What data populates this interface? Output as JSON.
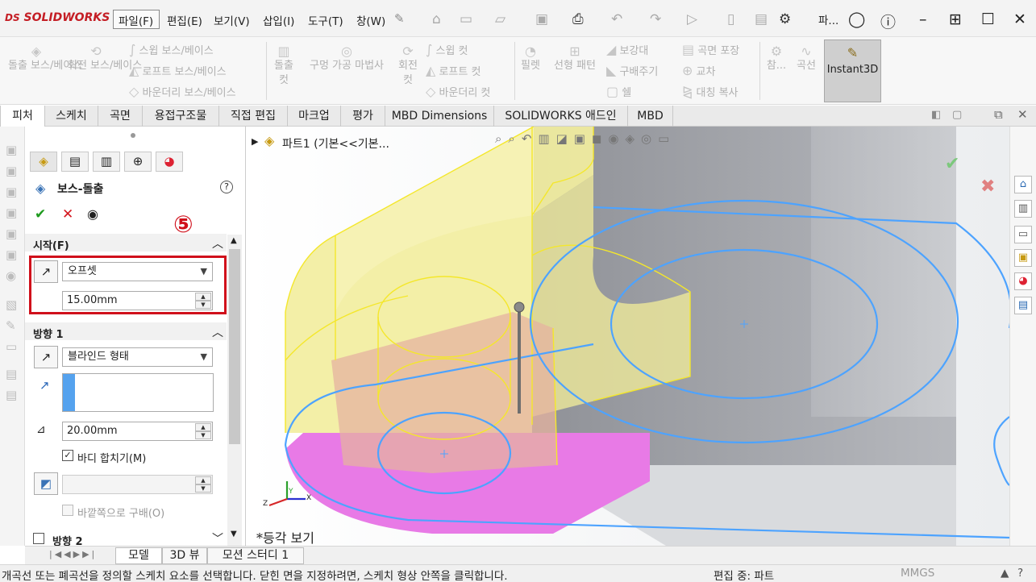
{
  "app": {
    "brand": "SOLIDWORKS",
    "brand_mark": "DS"
  },
  "menu": {
    "items": [
      "파일(F)",
      "편집(E)",
      "보기(V)",
      "삽입(I)",
      "도구(T)",
      "창(W)"
    ],
    "doc_short": "파..."
  },
  "ribbon": {
    "boss_extrude": "돌출 보스/베이스",
    "revolve_boss": "회전 보스/베이스",
    "sweep_boss": "스윕 보스/베이스",
    "loft_boss": "로프트 보스/베이스",
    "boundary_boss": "바운더리 보스/베이스",
    "extrude_cut": "돌출 컷",
    "hole_wizard": "구멍 가공 마법사",
    "revolve_cut": "회전 컷",
    "sweep_cut": "스윕 컷",
    "loft_cut": "로프트 컷",
    "boundary_cut": "바운더리 컷",
    "fillet": "필렛",
    "linear_pattern": "선형 패턴",
    "rib": "보강대",
    "draft": "구배주기",
    "shell": "쉘",
    "wrap": "곡면 포장",
    "intersect": "교차",
    "mirror": "대칭 복사",
    "reference": "참...",
    "curves": "곡선",
    "instant3d": "Instant3D"
  },
  "tabs": [
    "피처",
    "스케치",
    "곡면",
    "용접구조물",
    "직접 편집",
    "마크업",
    "평가",
    "MBD Dimensions",
    "SOLIDWORKS 애드인",
    "MBD"
  ],
  "pm": {
    "title": "보스-돌출",
    "help": "?",
    "annotation": "⑤",
    "from_section": "시작(F)",
    "from_type": "오프셋",
    "offset_value": "15.00mm",
    "dir1_section": "방향 1",
    "end_condition": "블라인드 형태",
    "depth_value": "20.00mm",
    "merge_result": "바디 합치기(M)",
    "draft_outward": "바깥쪽으로 구배(O)",
    "dir2_section": "방향 2"
  },
  "viewport": {
    "tree_label": "파트1  (기본<<기본...",
    "view_label": "*등각 보기",
    "triad": {
      "x": "X",
      "y": "Y",
      "z": "Z"
    }
  },
  "bottom_tabs": [
    "모델",
    "3D 뷰",
    "모션 스터디 1"
  ],
  "status": {
    "message": "개곡선 또는 폐곡선을 정의할 스케치 요소를 선택합니다. 닫힌 면을 지정하려면, 스케치 형상 안쪽을 클릭합니다.",
    "mode": "편집 중: 파트",
    "units": "MMGS"
  },
  "colors": {
    "accent_red": "#d0101b",
    "sketch_blue": "#4da3ff",
    "preview_yellow": "#f3ef9c",
    "preview_magenta": "#e678e6",
    "model_gray": "#a5a7ad"
  }
}
